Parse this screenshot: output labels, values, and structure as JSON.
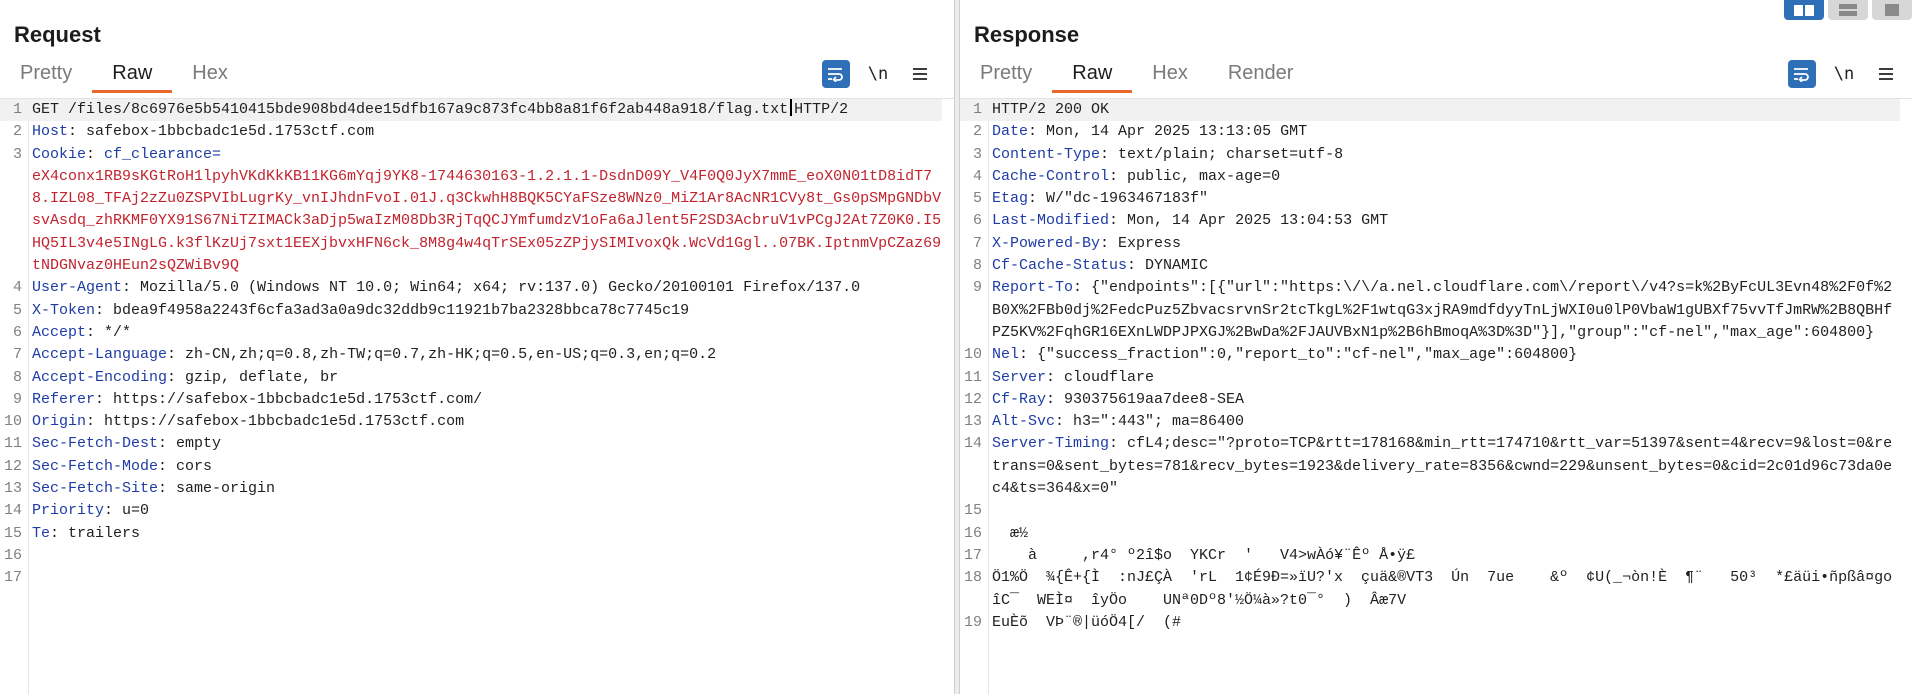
{
  "request": {
    "title": "Request",
    "tabs": [
      {
        "label": "Pretty",
        "active": false
      },
      {
        "label": "Raw",
        "active": true
      },
      {
        "label": "Hex",
        "active": false
      }
    ],
    "tools": {
      "wrap_icon": "wrap-lines-icon",
      "newline_label": "\\n",
      "menu_icon": "menu-icon"
    },
    "lines": [
      {
        "no": "1",
        "head": "",
        "value": "GET /files/8c6976e5b5410415bde908bd4dee15dfb167a9c873fc4bb8a81f6f2ab448a918/flag.txt",
        "tail": "HTTP/2"
      },
      {
        "no": "2",
        "head": "Host",
        "value": "safebox-1bbcbadc1e5d.1753ctf.com"
      },
      {
        "no": "3",
        "head": "Cookie",
        "cookie_name": "cf_clearance=",
        "cookie_value": "eX4conx1RB9sKGtRoH1lpyhVKdKkKB11KG6mYqj9YK8-1744630163-1.2.1.1-DsdnD09Y_V4F0Q0JyX7mmE_eoX0N01tD8idT78.IZL08_TFAj2zZu0ZSPVIbLugrKy_vnIJhdnFvoI.01J.q3CkwhH8BQK5CYaFSze8WNz0_MiZ1Ar8AcNR1CVy8t_Gs0pSMpGNDbVsvAsdq_zhRKMF0YX91S67NiTZIMACk3aDjp5waIzM08Db3RjTqQCJYmfumdzV1oFa6aJlent5F2SD3AcbruV1vPCgJ2At7Z0K0.I5HQ5IL3v4e5INgLG.k3flKzUj7sxt1EEXjbvxHFN6ck_8M8g4w4qTrSEx05zZPjySIMIvoxQk.WcVd1Ggl..07BK.IptnmVpCZaz69tNDGNvaz0HEun2sQZWiBv9Q"
      },
      {
        "no": "4",
        "head": "User-Agent",
        "value": "Mozilla/5.0 (Windows NT 10.0; Win64; x64; rv:137.0) Gecko/20100101 Firefox/137.0"
      },
      {
        "no": "5",
        "head": "X-Token",
        "value": "bdea9f4958a2243f6cfa3ad3a0a9dc32ddb9c11921b7ba2328bbca78c7745c19"
      },
      {
        "no": "6",
        "head": "Accept",
        "value": "*/*"
      },
      {
        "no": "7",
        "head": "Accept-Language",
        "value": "zh-CN,zh;q=0.8,zh-TW;q=0.7,zh-HK;q=0.5,en-US;q=0.3,en;q=0.2"
      },
      {
        "no": "8",
        "head": "Accept-Encoding",
        "value": "gzip, deflate, br"
      },
      {
        "no": "9",
        "head": "Referer",
        "value": "https://safebox-1bbcbadc1e5d.1753ctf.com/"
      },
      {
        "no": "10",
        "head": "Origin",
        "value": "https://safebox-1bbcbadc1e5d.1753ctf.com"
      },
      {
        "no": "11",
        "head": "Sec-Fetch-Dest",
        "value": "empty"
      },
      {
        "no": "12",
        "head": "Sec-Fetch-Mode",
        "value": "cors"
      },
      {
        "no": "13",
        "head": "Sec-Fetch-Site",
        "value": "same-origin"
      },
      {
        "no": "14",
        "head": "Priority",
        "value": "u=0"
      },
      {
        "no": "15",
        "head": "Te",
        "value": "trailers"
      },
      {
        "no": "16",
        "head": "",
        "value": ""
      },
      {
        "no": "17",
        "head": "",
        "value": ""
      }
    ]
  },
  "response": {
    "title": "Response",
    "tabs": [
      {
        "label": "Pretty",
        "active": false
      },
      {
        "label": "Raw",
        "active": true
      },
      {
        "label": "Hex",
        "active": false
      },
      {
        "label": "Render",
        "active": false
      }
    ],
    "tools": {
      "wrap_icon": "wrap-lines-icon",
      "newline_label": "\\n",
      "menu_icon": "menu-icon"
    },
    "lines": [
      {
        "no": "1",
        "head": "",
        "value": "HTTP/2 200 OK"
      },
      {
        "no": "2",
        "head": "Date",
        "value": "Mon, 14 Apr 2025 13:13:05 GMT"
      },
      {
        "no": "3",
        "head": "Content-Type",
        "value": "text/plain; charset=utf-8"
      },
      {
        "no": "4",
        "head": "Cache-Control",
        "value": "public, max-age=0"
      },
      {
        "no": "5",
        "head": "Etag",
        "value": "W/\"dc-1963467183f\""
      },
      {
        "no": "6",
        "head": "Last-Modified",
        "value": "Mon, 14 Apr 2025 13:04:53 GMT"
      },
      {
        "no": "7",
        "head": "X-Powered-By",
        "value": "Express"
      },
      {
        "no": "8",
        "head": "Cf-Cache-Status",
        "value": "DYNAMIC"
      },
      {
        "no": "9",
        "head": "Report-To",
        "value": "{\"endpoints\":[{\"url\":\"https:\\/\\/a.nel.cloudflare.com\\/report\\/v4?s=k%2ByFcUL3Evn48%2F0f%2B0X%2FBb0dj%2FedcPuz5ZbvacsrvnSr2tcTkgL%2F1wtqG3xjRA9mdfdyyTnLjWXI0u0lP0VbaW1gUBXf75vvTfJmRW%2B8QBHfPZ5KV%2FqhGR16EXnLWDPJPXGJ%2BwDa%2FJAUVBxN1p%2B6hBmoqA%3D%3D\"}],\"group\":\"cf-nel\",\"max_age\":604800}"
      },
      {
        "no": "10",
        "head": "Nel",
        "value": "{\"success_fraction\":0,\"report_to\":\"cf-nel\",\"max_age\":604800}"
      },
      {
        "no": "11",
        "head": "Server",
        "value": "cloudflare"
      },
      {
        "no": "12",
        "head": "Cf-Ray",
        "value": "930375619aa7dee8-SEA"
      },
      {
        "no": "13",
        "head": "Alt-Svc",
        "value": "h3=\":443\"; ma=86400"
      },
      {
        "no": "14",
        "head": "Server-Timing",
        "value": "cfL4;desc=\"?proto=TCP&rtt=178168&min_rtt=174710&rtt_var=51397&sent=4&recv=9&lost=0&retrans=0&sent_bytes=781&recv_bytes=1923&delivery_rate=8356&cwnd=229&unsent_bytes=0&cid=2c01d96c73da0ec4&ts=364&x=0\""
      },
      {
        "no": "15",
        "head": "",
        "value": ""
      },
      {
        "no": "16",
        "head": "",
        "value": "  æ½"
      },
      {
        "no": "17",
        "head": "",
        "value": "    à     ,r4° º2î$o  YKCr  '   V4>wÀó¥¨Êº Å•ÿ£"
      },
      {
        "no": "18",
        "head": "",
        "value": "Ö1%Ö  ¾{Ê+{Ì  :nJ£ÇÀ  'rL  1¢É9Ð=»ïU?'x  çuä&®VT3  Ún  7ue    &º  ¢U(_¬òn!È  ¶¨   50³  *£äüi•ñpßâ¤goîC¯  WEÌ¤  îyÖo    UNª0Dº8'½Ö¼à»?t0¯°  )  Âæ7V"
      },
      {
        "no": "19",
        "head": "",
        "value": "EuÈõ  VÞ¨®|üóÖ4[/  (#"
      }
    ]
  },
  "layout_icons": [
    "split-horizontal-icon",
    "split-vertical-icon",
    "single-pane-icon"
  ]
}
